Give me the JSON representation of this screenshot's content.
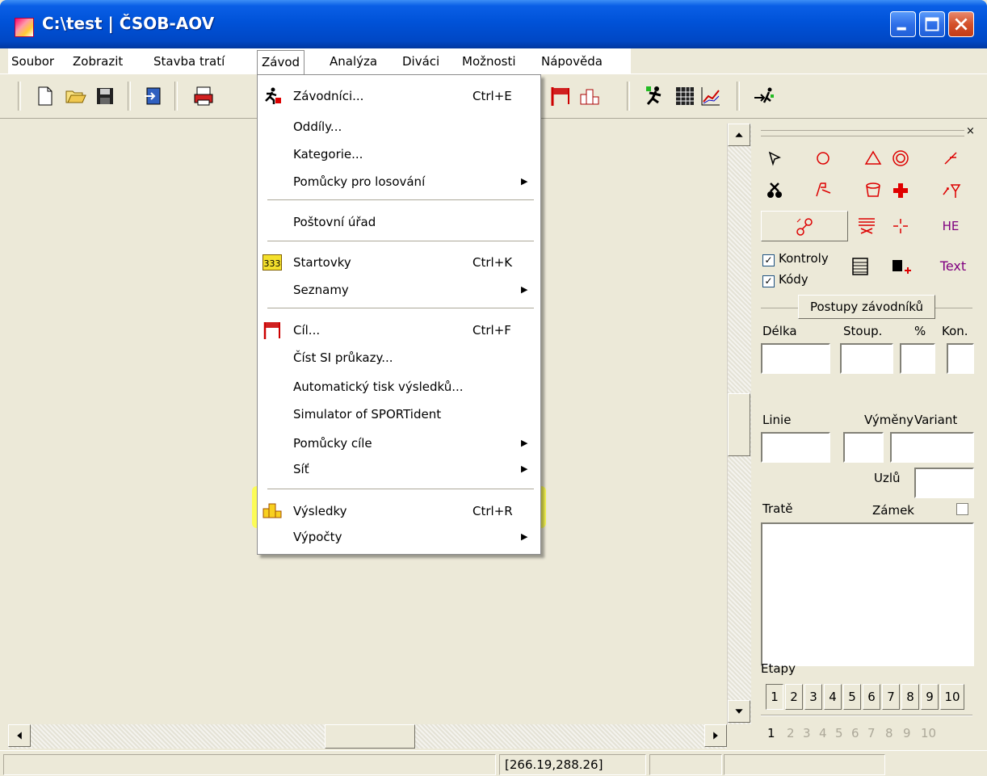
{
  "window": {
    "title": "C:\\test  |  ČSOB-AOV"
  },
  "menubar": {
    "items": [
      "Soubor",
      "Zobrazit",
      "Stavba tratí",
      "Závod",
      "Analýza",
      "Diváci",
      "Možnosti",
      "Nápověda"
    ],
    "open_item": "Závod"
  },
  "dropdown": {
    "items": [
      {
        "label": "Závodníci...",
        "shortcut": "Ctrl+E",
        "icon": "runner-icon"
      },
      {
        "label": "Oddíly..."
      },
      {
        "label": "Kategorie..."
      },
      {
        "label": "Pomůcky pro losování",
        "submenu": true
      },
      {
        "label": "Poštovní úřad"
      },
      {
        "label": "Startovky",
        "shortcut": "Ctrl+K",
        "icon": "startlist-icon",
        "icon_text": "333"
      },
      {
        "label": "Seznamy",
        "submenu": true
      },
      {
        "label": "Cíl...",
        "shortcut": "Ctrl+F",
        "icon": "finish-flag-icon"
      },
      {
        "label": "Číst SI průkazy..."
      },
      {
        "label": "Automatický tisk výsledků..."
      },
      {
        "label": "Simulator of SPORTident"
      },
      {
        "label": "Pomůcky cíle",
        "submenu": true
      },
      {
        "label": "Síť",
        "submenu": true
      },
      {
        "label": "Výsledky",
        "shortcut": "Ctrl+R",
        "icon": "podium-icon",
        "highlighted": true
      },
      {
        "label": "Výpočty",
        "submenu": true
      }
    ],
    "highlight_color": "#ffff40"
  },
  "panel": {
    "checkbox_kontroly": "Kontroly",
    "checkbox_kody": "Kódy",
    "text_tool": "Text",
    "he_tool": "HE",
    "postupy_button": "Postupy závodníků",
    "delka_label": "Délka",
    "stoup_label": "Stoup.",
    "percent_label": "%",
    "kon_label": "Kon.",
    "linie_label": "Linie",
    "vymeny_label": "Výměny",
    "variant_label": "Variant",
    "uzlu_label": "Uzlů",
    "trate_label": "Tratě",
    "zamek_label": "Zámek",
    "etapy_label": "Etapy",
    "stage_buttons": [
      "1",
      "2",
      "3",
      "4",
      "5",
      "6",
      "7",
      "8",
      "9",
      "10"
    ],
    "stage_numbers": [
      "1",
      "2",
      "3",
      "4",
      "5",
      "6",
      "7",
      "8",
      "9",
      "10"
    ]
  },
  "statusbar": {
    "coords": "[266.19,288.26]"
  },
  "colors": {
    "titlebar": "#0052d8",
    "face": "#ece9d8",
    "red_tool": "#e00000",
    "purple_tool": "#800080"
  }
}
